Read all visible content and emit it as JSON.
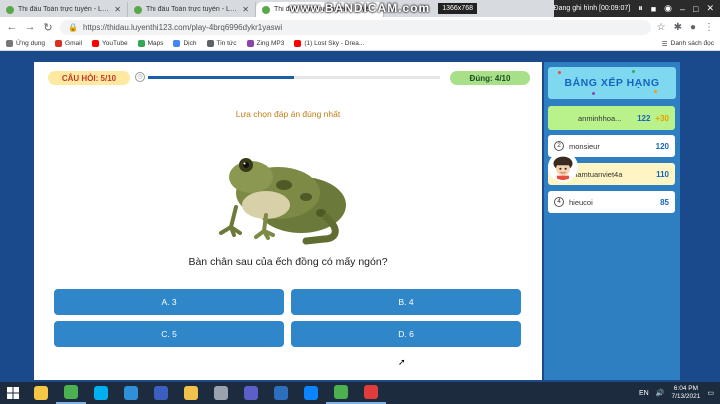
{
  "browser": {
    "tabs": [
      {
        "label": "Thi đấu Toán trực tuyến - Luyện...",
        "active": false
      },
      {
        "label": "Thi đấu Toán trực tuyến - Luyện...",
        "active": false
      },
      {
        "label": "Thi đấu Toán trực tuyến - Luyện...",
        "active": true
      }
    ],
    "new_tab_label": "+",
    "url": "https://thidau.luyenthi123.com/play-4brq6996dykr1yaswi",
    "bookmarks": [
      {
        "label": "Ứng dụng",
        "color": "#777777"
      },
      {
        "label": "Gmail",
        "color": "#d93025"
      },
      {
        "label": "YouTube",
        "color": "#ff0000"
      },
      {
        "label": "Maps",
        "color": "#34a853"
      },
      {
        "label": "Dịch",
        "color": "#4285f4"
      },
      {
        "label": "Tin tức",
        "color": "#5f6368"
      },
      {
        "label": "Zing MP3",
        "color": "#8e44ad"
      },
      {
        "label": "(1) Lost Sky - Drea...",
        "color": "#ff0000"
      }
    ],
    "reading_list_label": "Danh sách đọc"
  },
  "recording": {
    "brand": "www.BANDICAM.com",
    "resolution": "1366x768",
    "status": "Đang ghi hình [00:09:07]"
  },
  "quiz": {
    "question_counter": "CÂU HỎI: 5/10",
    "correct_counter": "Đúng: 4/10",
    "progress": 0.5,
    "instruction": "Lựa chọn đáp án đúng nhất",
    "question": "Bàn chân sau của ếch đồng có mấy ngón?",
    "answers": [
      "A. 3",
      "B. 4",
      "C. 5",
      "D. 6"
    ]
  },
  "leaderboard": {
    "title": "BẢNG XẾP HẠNG",
    "entries": [
      {
        "rank": "1",
        "name": "anminhhoa...",
        "score": "122",
        "bonus": "+30"
      },
      {
        "rank": "2",
        "name": "monsieur",
        "score": "120"
      },
      {
        "rank": "3",
        "name": "phamtuanviet4a",
        "score": "110"
      },
      {
        "rank": "4",
        "name": "hieucoi",
        "score": "85"
      }
    ]
  },
  "taskbar": {
    "language": "EN",
    "time": "6:04 PM",
    "date": "7/13/2021",
    "apps": [
      {
        "name": "file-explorer-icon",
        "color": "#f6c744",
        "running": false
      },
      {
        "name": "chrome-icon",
        "color": "#4caf50",
        "running": true
      },
      {
        "name": "skype-icon",
        "color": "#00aff0",
        "running": false
      },
      {
        "name": "edge-icon",
        "color": "#2f8fd8",
        "running": false
      },
      {
        "name": "media-icon",
        "color": "#3b5fc0",
        "running": false
      },
      {
        "name": "folder-icon",
        "color": "#f0c24b",
        "running": false
      },
      {
        "name": "calculator-icon",
        "color": "#9aa3ad",
        "running": false
      },
      {
        "name": "teams-icon",
        "color": "#5b5fc7",
        "running": false
      },
      {
        "name": "word-icon",
        "color": "#2b6fbe",
        "running": false
      },
      {
        "name": "zalo-icon",
        "color": "#0a84ff",
        "running": false
      },
      {
        "name": "chrome-icon-2",
        "color": "#4caf50",
        "running": true
      },
      {
        "name": "record-icon",
        "color": "#e03c3c",
        "running": true
      }
    ]
  }
}
